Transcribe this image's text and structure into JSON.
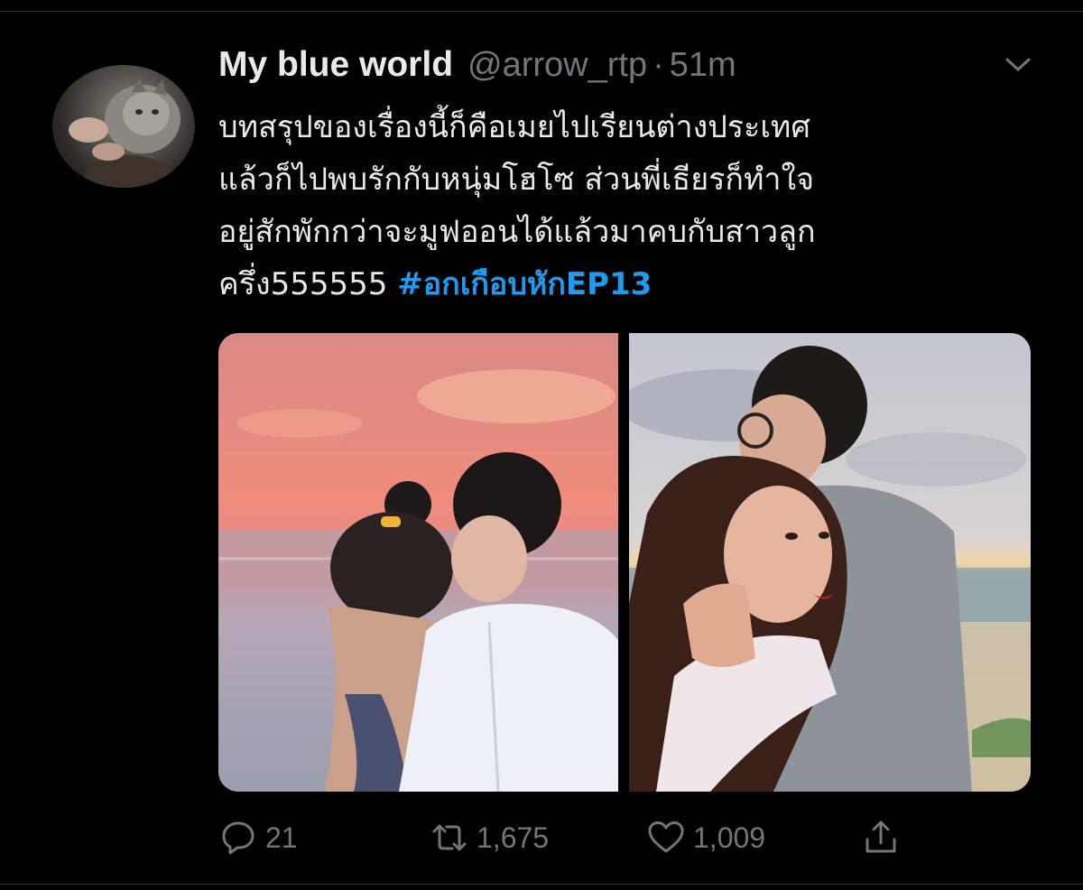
{
  "tweet": {
    "author": {
      "display_name": "My blue world",
      "handle": "@arrow_rtp",
      "separator": "·",
      "time": "51m"
    },
    "text_lines": [
      "บทสรุปของเรื่องนี้ก็คือเมยไปเรียนต่างประเทศ",
      "แล้วก็ไปพบรักกับหนุ่มโฮโซ ส่วนพี่เธียรก็ทำใจ",
      "อยู่สักพักกว่าจะมูฟออนได้แล้วมาคบกับสาวลูก"
    ],
    "last_line_text": "ครึ่ง555555 ",
    "hashtag": "#อกเกือบหักEP13",
    "media_count": 2,
    "actions": {
      "reply_count": "21",
      "retweet_count": "1,675",
      "like_count": "1,009"
    },
    "icons": {
      "more": "chevron-down-icon",
      "reply": "reply-icon",
      "retweet": "retweet-icon",
      "like": "heart-icon",
      "share": "share-icon"
    }
  },
  "colors": {
    "background": "#000000",
    "text": "#e7e9ea",
    "muted": "#71767b",
    "link": "#1d9bf0"
  }
}
